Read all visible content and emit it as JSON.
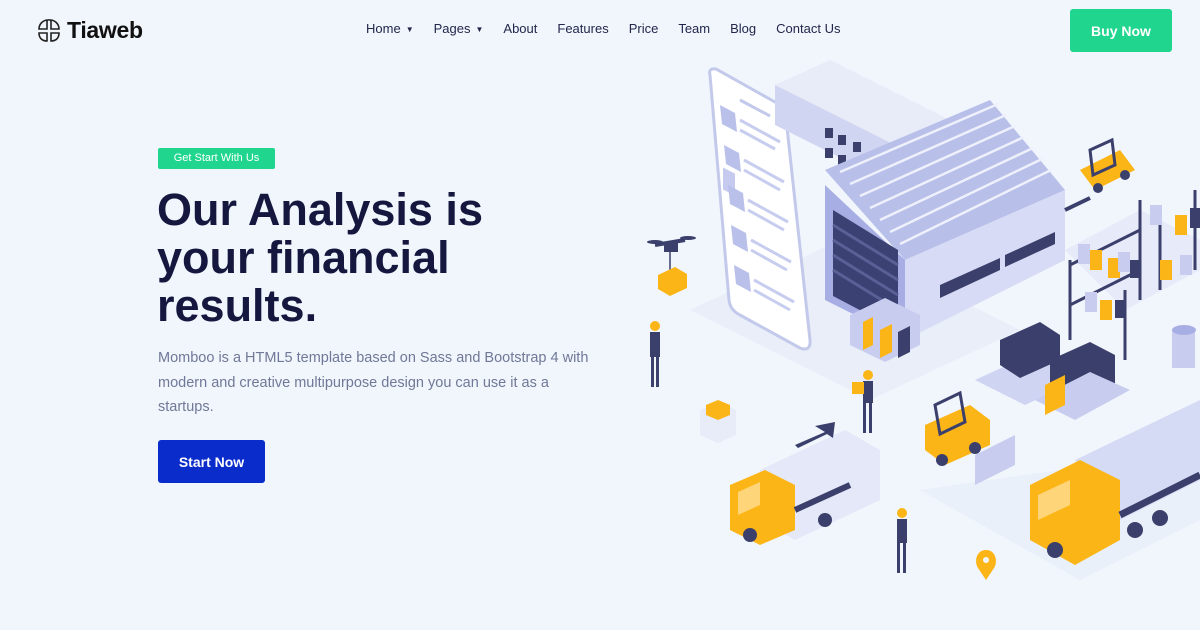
{
  "brand": {
    "name": "Tiaweb",
    "logo_icon": "four-petal-logo-icon"
  },
  "nav": {
    "items": [
      {
        "label": "Home",
        "dropdown": true
      },
      {
        "label": "Pages",
        "dropdown": true
      },
      {
        "label": "About",
        "dropdown": false
      },
      {
        "label": "Features",
        "dropdown": false
      },
      {
        "label": "Price",
        "dropdown": false
      },
      {
        "label": "Team",
        "dropdown": false
      },
      {
        "label": "Blog",
        "dropdown": false
      },
      {
        "label": "Contact Us",
        "dropdown": false
      }
    ],
    "chevron_icon": "chevron-down-icon"
  },
  "header": {
    "buy_label": "Buy Now"
  },
  "hero": {
    "badge": "Get Start With Us",
    "title": "Our Analysis is your financial results.",
    "description": "Momboo is a HTML5 template based on Sass and Bootstrap 4 with modern and creative multipurpose design you can use it as a startups.",
    "cta_label": "Start Now"
  },
  "colors": {
    "background": "#f1f6fd",
    "accent_green": "#20d68e",
    "primary_blue": "#0a2ccb",
    "heading": "#16173f",
    "body_text": "#707897",
    "illustration_yellow": "#fbb516",
    "illustration_lavender": "#c8cdef",
    "illustration_navy": "#3b3f6b"
  }
}
